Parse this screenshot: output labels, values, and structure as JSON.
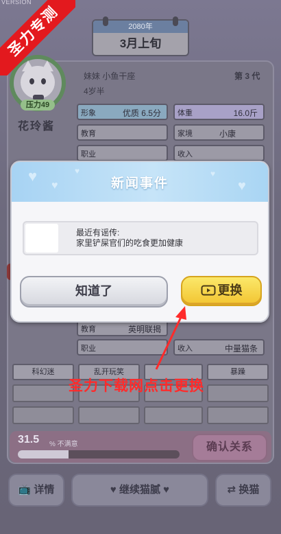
{
  "version_label": "VERSION",
  "ribbon": "圣力专测",
  "calendar": {
    "year": "2080年",
    "period": "3月上旬"
  },
  "cat": {
    "pressure": "压力49",
    "name": "花玲酱",
    "tags": "妹妹 小鱼干座",
    "age": "4岁半",
    "generation": "第 3 代"
  },
  "fields": {
    "appearance_label": "形象",
    "appearance_value": "优质 6.5分",
    "weight_label": "体重",
    "weight_value": "16.0斤",
    "education_label": "教育",
    "family_label": "家境",
    "family_value": "小康",
    "job_label": "职业",
    "income_label": "收入"
  },
  "partner_fields": {
    "education_label": "教育",
    "education_value": "英明联揭",
    "job_label": "职业",
    "income_label": "收入",
    "income_value": "中量猫条"
  },
  "traits": [
    "科幻迷",
    "乱开玩笑",
    "暴躁"
  ],
  "score": {
    "value": "31.5",
    "unit": "% 不满意",
    "fraction": 0.315
  },
  "confirm_label": "确认关系",
  "bottom": {
    "details": "详情",
    "continue": "继续猫腻",
    "switch": "换猫"
  },
  "dialog": {
    "title": "新闻事件",
    "news_line1": "最近有谣传:",
    "news_line2": "家里铲屎官们的吃食更加健康",
    "ok_label": "知道了",
    "change_label": "更换"
  },
  "annotation": "圣力下载网点击更换",
  "colors": {
    "dialog_header": "#a7d3f3",
    "change_button": "#f2c431",
    "annotation": "#ff2b2b",
    "ribbon": "#e3191e"
  }
}
